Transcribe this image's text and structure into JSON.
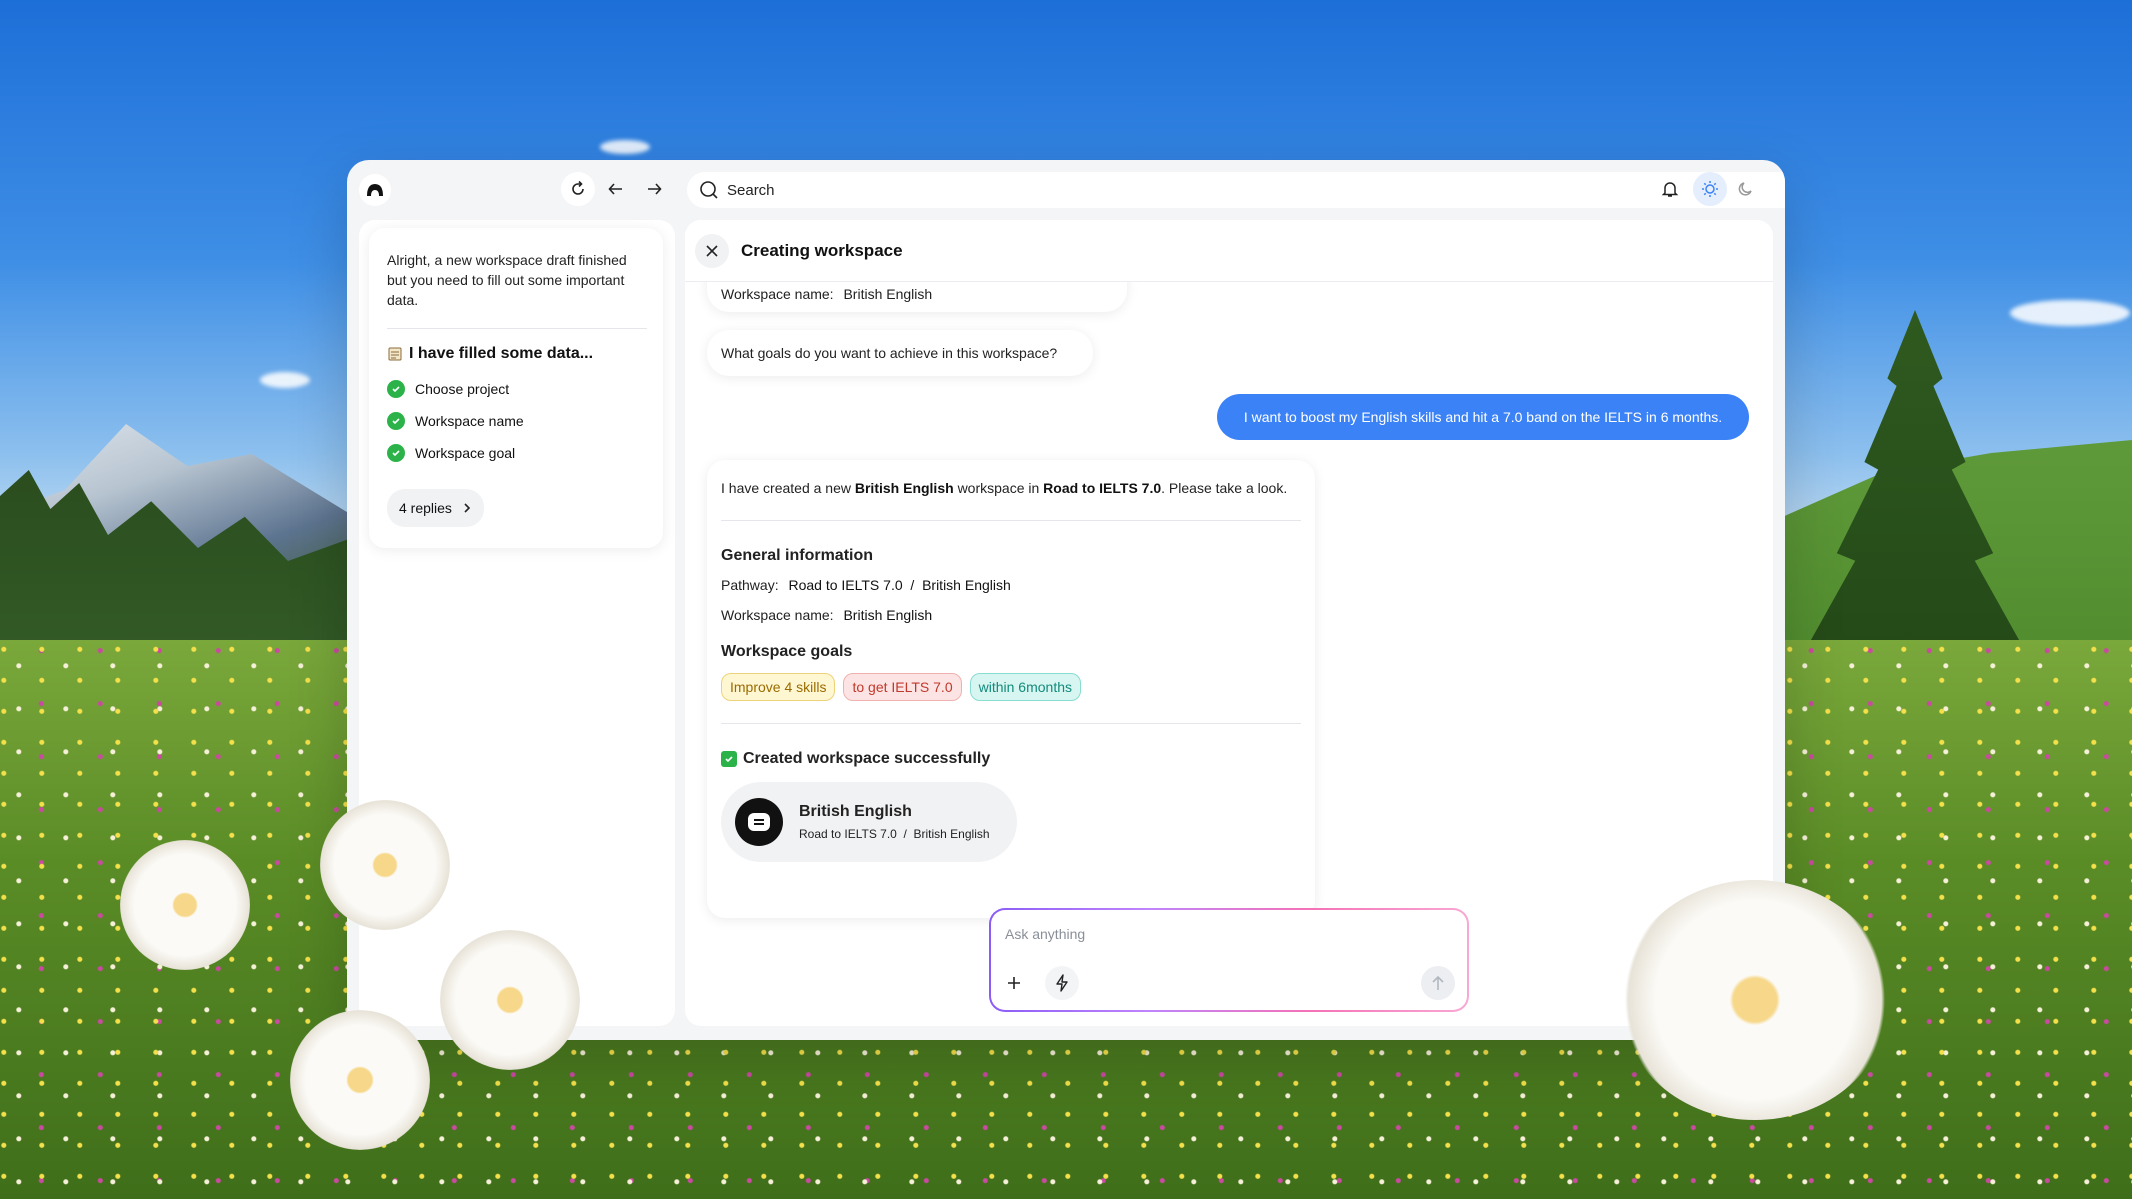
{
  "topbar": {
    "search_label": "Search"
  },
  "sidebar_card": {
    "message": "Alright, a new workspace draft finished but you need to fill out some important data.",
    "title": "I have filled some data...",
    "items": [
      {
        "label": "Choose project"
      },
      {
        "label": "Workspace name"
      },
      {
        "label": "Workspace goal"
      }
    ],
    "replies_label": "4 replies"
  },
  "main": {
    "title": "Creating workspace",
    "prev_bubble": {
      "label": "Workspace name:",
      "value": "British English"
    },
    "question": "What goals do you want to achieve in this workspace?",
    "user_message": "I want to boost my English skills and hit a 7.0 band on the IELTS in 6 months.",
    "reply": {
      "intro_pre": "I have created a new",
      "intro_ws": "British English",
      "intro_mid": "workspace in",
      "intro_path": "Road to IELTS 7.0",
      "intro_post": ". Please take a look.",
      "general_title": "General information",
      "pathway_label": "Pathway:",
      "pathway_value": "Road to IELTS 7.0  /  British English",
      "ws_name_label": "Workspace name:",
      "ws_name_value": "British English",
      "goals_title": "Workspace goals",
      "tags": [
        "Improve 4 skills",
        "to get IELTS 7.0",
        "within 6months"
      ],
      "success_label": "Created workspace successfully",
      "ws_card_name": "British English",
      "ws_card_path": "Road to IELTS 7.0  /  British English"
    }
  },
  "composer": {
    "placeholder": "Ask anything"
  },
  "colors": {
    "accent_blue": "#3b82f6",
    "check_green": "#2bb34a",
    "tag_yellow": "#fff7d1",
    "tag_red": "#fde4e4",
    "tag_teal": "#d7f6f1"
  },
  "icons": [
    "app-logo-icon",
    "refresh-icon",
    "arrow-left-icon",
    "arrow-right-icon",
    "search-icon",
    "bell-icon",
    "sun-icon",
    "moon-icon",
    "close-icon",
    "check-icon",
    "chevron-right-icon",
    "workspace-avatar-icon",
    "plus-icon",
    "bolt-icon",
    "send-arrow-icon",
    "notepad-icon"
  ]
}
